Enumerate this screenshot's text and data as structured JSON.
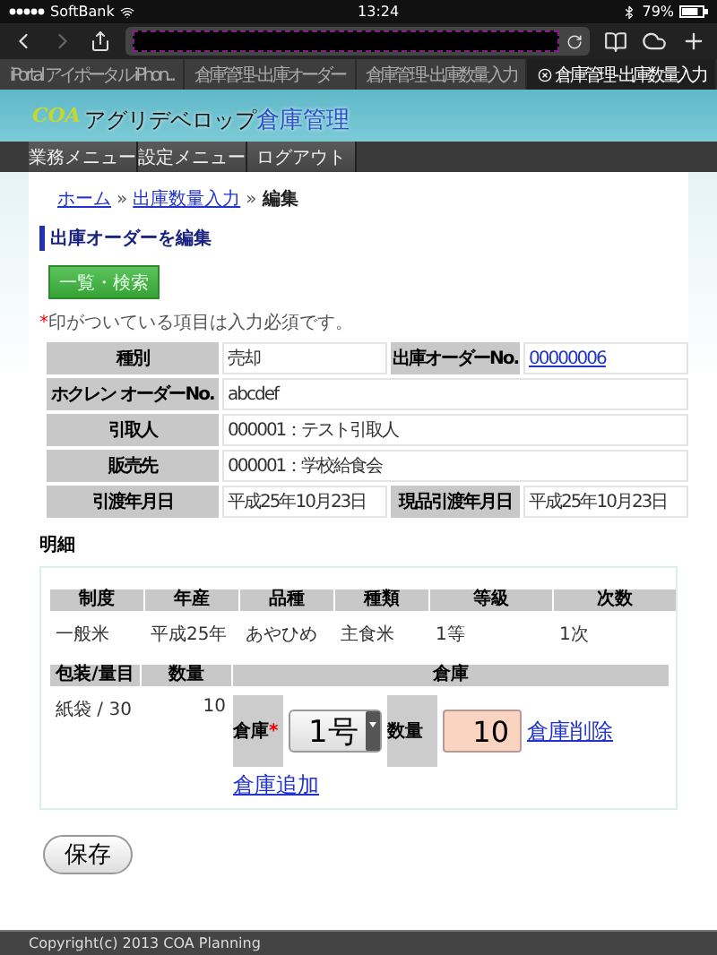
{
  "status_bar": {
    "carrier": "SoftBank",
    "time": "13:24",
    "battery": "79%"
  },
  "browser_tabs": [
    {
      "label": "iPortal アイポータル iPhon...",
      "selected": false
    },
    {
      "label": "倉庫管理- 出庫オーダー",
      "selected": false
    },
    {
      "label": "倉庫管理- 出庫数量入力",
      "selected": false
    },
    {
      "label": "倉庫管理- 出庫数量入力",
      "selected": true
    }
  ],
  "logo": {
    "brand": "COA",
    "title": "アグリデベロップ",
    "highlight": "倉庫管理"
  },
  "menu": [
    "業務メニュー",
    "設定メニュー",
    "ログアウト"
  ],
  "breadcrumb_separator": "»",
  "breadcrumb": [
    {
      "label": "ホーム",
      "link": true
    },
    {
      "label": "出庫数量入力",
      "link": true
    },
    {
      "label": "編集",
      "link": false
    }
  ],
  "heading": "出庫オーダーを編集",
  "list_button": "一覧・検索",
  "note": {
    "mark": "*",
    "text": "印がついている項目は入力必須です。"
  },
  "order_rows": [
    [
      {
        "label": "種別",
        "value": "売却",
        "link": false
      },
      {
        "label": "出庫オーダーNo.",
        "value": "00000006",
        "link": true
      }
    ],
    [
      {
        "label": "ホクレン オーダーNo.",
        "value": "abcdef",
        "link": false
      }
    ],
    [
      {
        "label": "引取人",
        "value": "000001：テスト引取人",
        "link": false
      }
    ],
    [
      {
        "label": "販売先",
        "value": "000001：学校給食会",
        "link": false
      }
    ],
    [
      {
        "label": "引渡年月日",
        "value": "平成25年10月23日",
        "link": false
      },
      {
        "label": "現品引渡年月日",
        "value": "平成25年10月23日",
        "link": false
      }
    ]
  ],
  "detail": {
    "title": "明細",
    "spec_columns": [
      "制度",
      "年産",
      "品種",
      "種類",
      "等級",
      "次数"
    ],
    "spec_values": [
      "一般米",
      "平成25年",
      "あやひめ",
      "主食米",
      "1等",
      "1次"
    ],
    "stock_columns": [
      "包装/量目",
      "数量",
      "倉庫"
    ],
    "package": "紙袋 / 30",
    "quantity": "10",
    "warehouses": [
      {
        "label": "倉庫",
        "required_mark": "*",
        "selected": "1号",
        "quantity_label": "数量",
        "quantity": "10",
        "delete_link": "倉庫削除"
      }
    ],
    "add_link": "倉庫追加"
  },
  "save_button": "保存",
  "footer": "Copyright(c) 2013 COA Planning"
}
